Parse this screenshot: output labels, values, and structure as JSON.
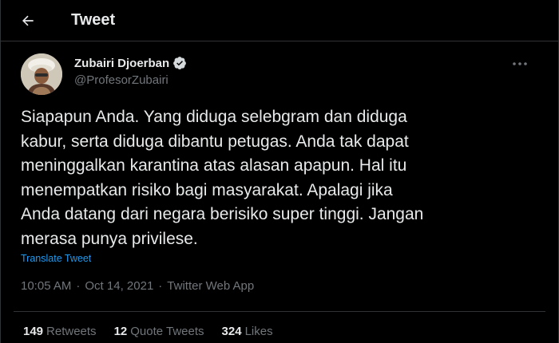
{
  "header": {
    "title": "Tweet",
    "back_icon": "arrow-left-icon"
  },
  "tweet": {
    "author": {
      "display_name": "Zubairi Djoerban",
      "handle": "@ProfesorZubairi",
      "verified_icon": "verified-badge-icon",
      "verified_color": "#d6d9db"
    },
    "more_icon": "more-horizontal-icon",
    "text": "Siapapun Anda. Yang diduga selebgram dan diduga\nkabur, serta diduga dibantu petugas. Anda tak dapat\nmeninggalkan karantina atas alasan apapun. Hal itu\nmenempatkan risiko bagi masyarakat. Apalagi jika\nAnda datang dari negara berisiko super tinggi. Jangan\nmerasa punya privilese.",
    "translate_label": "Translate Tweet",
    "time": "10:05 AM",
    "separator": "·",
    "date": "Oct 14, 2021",
    "source": "Twitter Web App",
    "stats": {
      "retweets_count": "149",
      "retweets_label": "Retweets",
      "quotes_count": "12",
      "quotes_label": "Quote Tweets",
      "likes_count": "324",
      "likes_label": "Likes"
    }
  },
  "colors": {
    "background": "#000000",
    "text_primary": "#e7e9ea",
    "text_secondary": "#71767b",
    "link": "#1d9bf0",
    "border": "#2f3336"
  }
}
